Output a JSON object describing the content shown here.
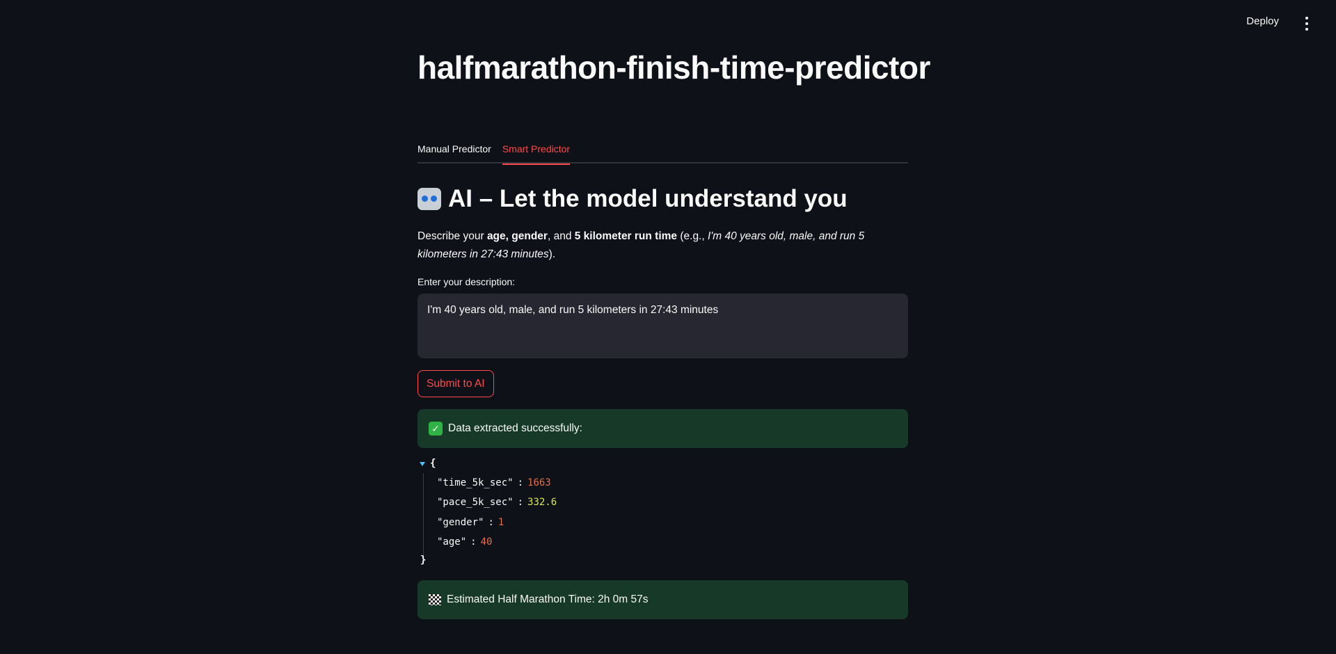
{
  "header": {
    "deploy_label": "Deploy"
  },
  "page": {
    "title": "halfmarathon-finish-time-predictor"
  },
  "tabs": [
    {
      "label": "Manual Predictor",
      "active": false
    },
    {
      "label": "Smart Predictor",
      "active": true
    }
  ],
  "section": {
    "heading": "AI – Let the model understand you",
    "heading_icon": "robot-icon",
    "desc_prefix": "Describe your ",
    "desc_age": "age",
    "desc_sep1": ", ",
    "desc_gender": "gender",
    "desc_sep2": ", and ",
    "desc_time": "5 kilometer run time",
    "desc_eg": " (e.g., ",
    "desc_example": "I'm 40 years old, male, and run 5 kilometers in 27:43 minutes",
    "desc_suffix": ")."
  },
  "input": {
    "label": "Enter your description:",
    "value": "I'm 40 years old, male, and run 5 kilometers in 27:43 minutes"
  },
  "submit_label": "Submit to AI",
  "success": {
    "icon": "check-mark-icon",
    "text": "Data extracted successfully:"
  },
  "json_view": {
    "open_brace": "{",
    "close_brace": "}",
    "entries": [
      {
        "key": "\"time_5k_sec\"",
        "value": "1663",
        "kind": "int"
      },
      {
        "key": "\"pace_5k_sec\"",
        "value": "332.6",
        "kind": "float"
      },
      {
        "key": "\"gender\"",
        "value": "1",
        "kind": "int"
      },
      {
        "key": "\"age\"",
        "value": "40",
        "kind": "int"
      }
    ]
  },
  "result": {
    "icon": "checkered-flag-icon",
    "text": "Estimated Half Marathon Time: 2h 0m 57s"
  },
  "colors": {
    "background": "#0e1117",
    "accent": "#ff4b4b",
    "success_bg": "#173928",
    "input_bg": "#262730"
  }
}
